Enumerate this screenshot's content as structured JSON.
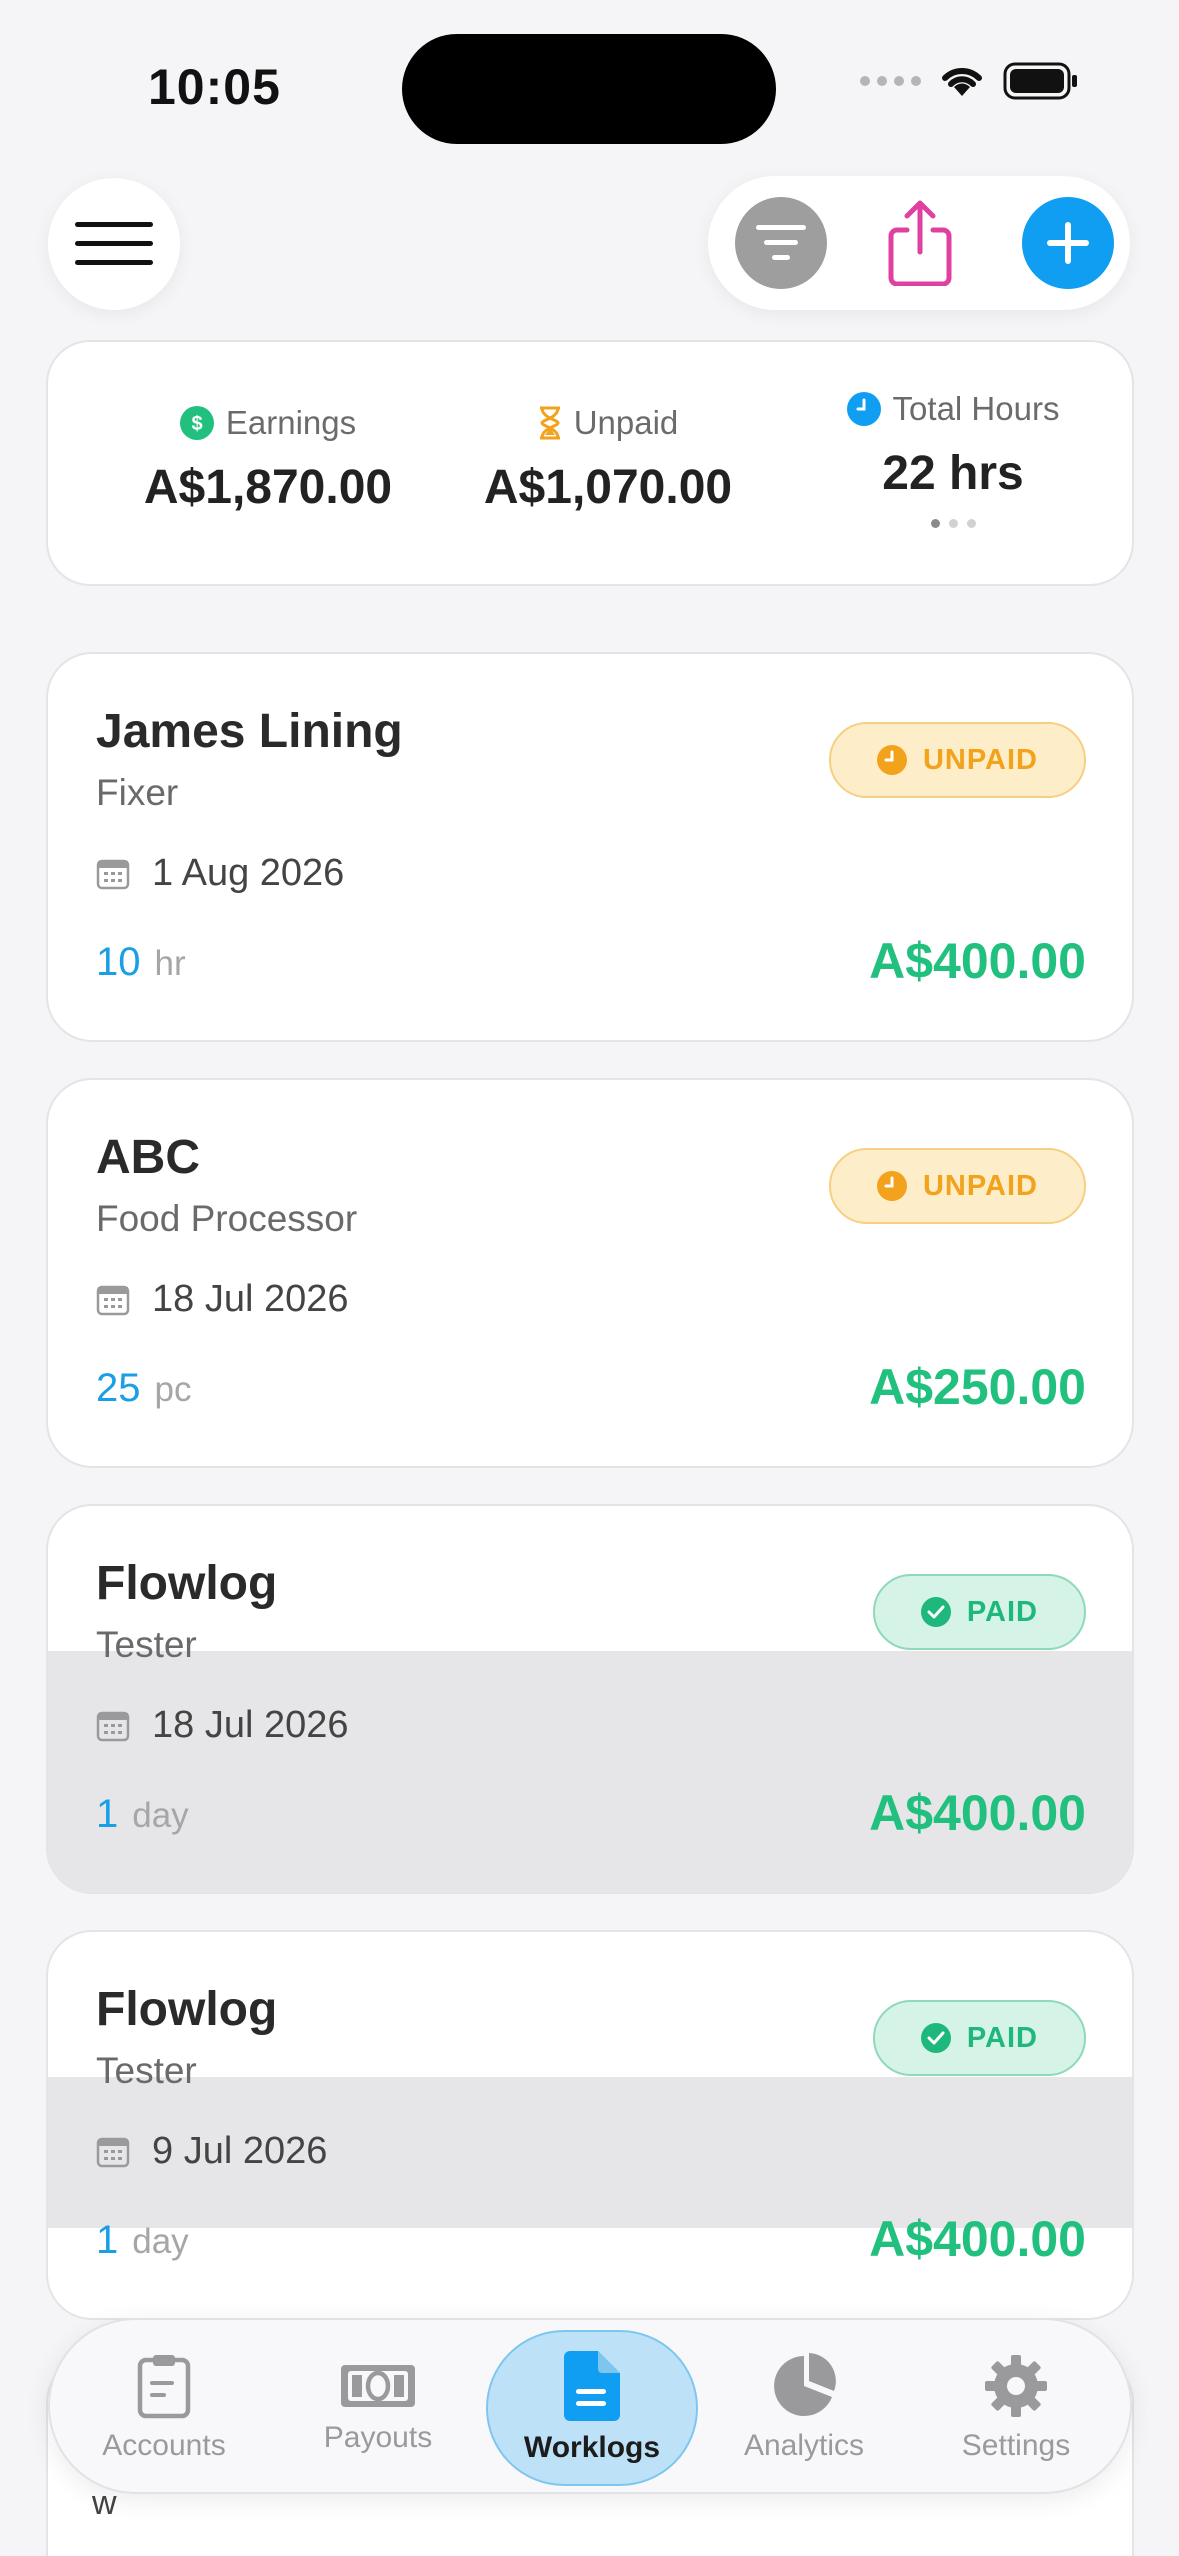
{
  "status_bar": {
    "time": "10:05"
  },
  "summary": {
    "earnings_label": "Earnings",
    "earnings_value": "A$1,870.00",
    "unpaid_label": "Unpaid",
    "unpaid_value": "A$1,070.00",
    "hours_label": "Total Hours",
    "hours_value": "22 hrs"
  },
  "worklogs": [
    {
      "title": "James Lining",
      "subtitle": "Fixer",
      "date": "1 Aug 2026",
      "qty": "10",
      "unit": "hr",
      "amount": "A$400.00",
      "status": "UNPAID"
    },
    {
      "title": "ABC",
      "subtitle": "Food Processor",
      "date": "18 Jul 2026",
      "qty": "25",
      "unit": "pc",
      "amount": "A$250.00",
      "status": "UNPAID"
    },
    {
      "title": "Flowlog",
      "subtitle": "Tester",
      "date": "18 Jul 2026",
      "qty": "1",
      "unit": "day",
      "amount": "A$400.00",
      "status": "PAID"
    },
    {
      "title": "Flowlog",
      "subtitle": "Tester",
      "date": "9 Jul 2026",
      "qty": "1",
      "unit": "day",
      "amount": "A$400.00",
      "status": "PAID"
    }
  ],
  "peek_text": "w",
  "tabs": [
    {
      "label": "Accounts",
      "icon": "clipboard-icon"
    },
    {
      "label": "Payouts",
      "icon": "banknote-icon"
    },
    {
      "label": "Worklogs",
      "icon": "document-icon",
      "active": true
    },
    {
      "label": "Analytics",
      "icon": "pie-chart-icon"
    },
    {
      "label": "Settings",
      "icon": "gear-icon"
    }
  ],
  "colors": {
    "accent": "#0f9ef2",
    "paid": "#1fb87c",
    "unpaid": "#f2a21b",
    "amount": "#22c07e",
    "share": "#e040a0"
  }
}
